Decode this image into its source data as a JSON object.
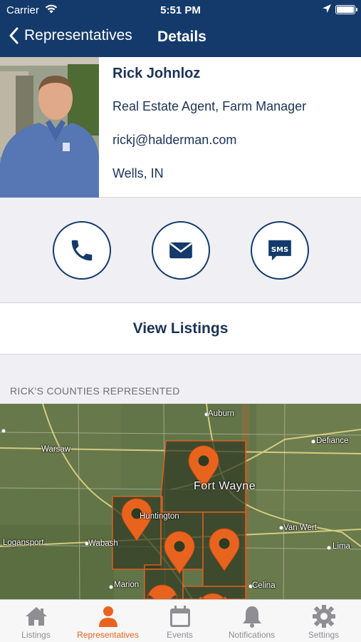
{
  "status": {
    "carrier": "Carrier",
    "time": "5:51 PM"
  },
  "nav": {
    "back_label": "Representatives",
    "title": "Details"
  },
  "rep": {
    "name": "Rick Johnloz",
    "title": "Real Estate Agent, Farm Manager",
    "email": "rickj@halderman.com",
    "location": "Wells, IN"
  },
  "actions": {
    "view_listings": "View Listings"
  },
  "counties": {
    "header": "RICK'S COUNTIES REPRESENTED",
    "map_labels": {
      "auburn": "Auburn",
      "warsaw": "Warsaw",
      "defiance": "Defiance",
      "fort_wayne": "Fort Wayne",
      "huntington": "Huntington",
      "van_wert": "Van Wert",
      "logansport": "Logansport",
      "wabash": "Wabash",
      "lima": "Lima",
      "marion": "Marion",
      "celina": "Celina"
    }
  },
  "tabs": [
    {
      "label": "Listings",
      "icon": "house-icon"
    },
    {
      "label": "Representatives",
      "icon": "person-icon"
    },
    {
      "label": "Events",
      "icon": "calendar-icon"
    },
    {
      "label": "Notifications",
      "icon": "bell-icon"
    },
    {
      "label": "Settings",
      "icon": "gear-icon"
    }
  ],
  "colors": {
    "nav_bg": "#143a6b",
    "accent": "#e8641e",
    "text_dark": "#1c3355"
  }
}
